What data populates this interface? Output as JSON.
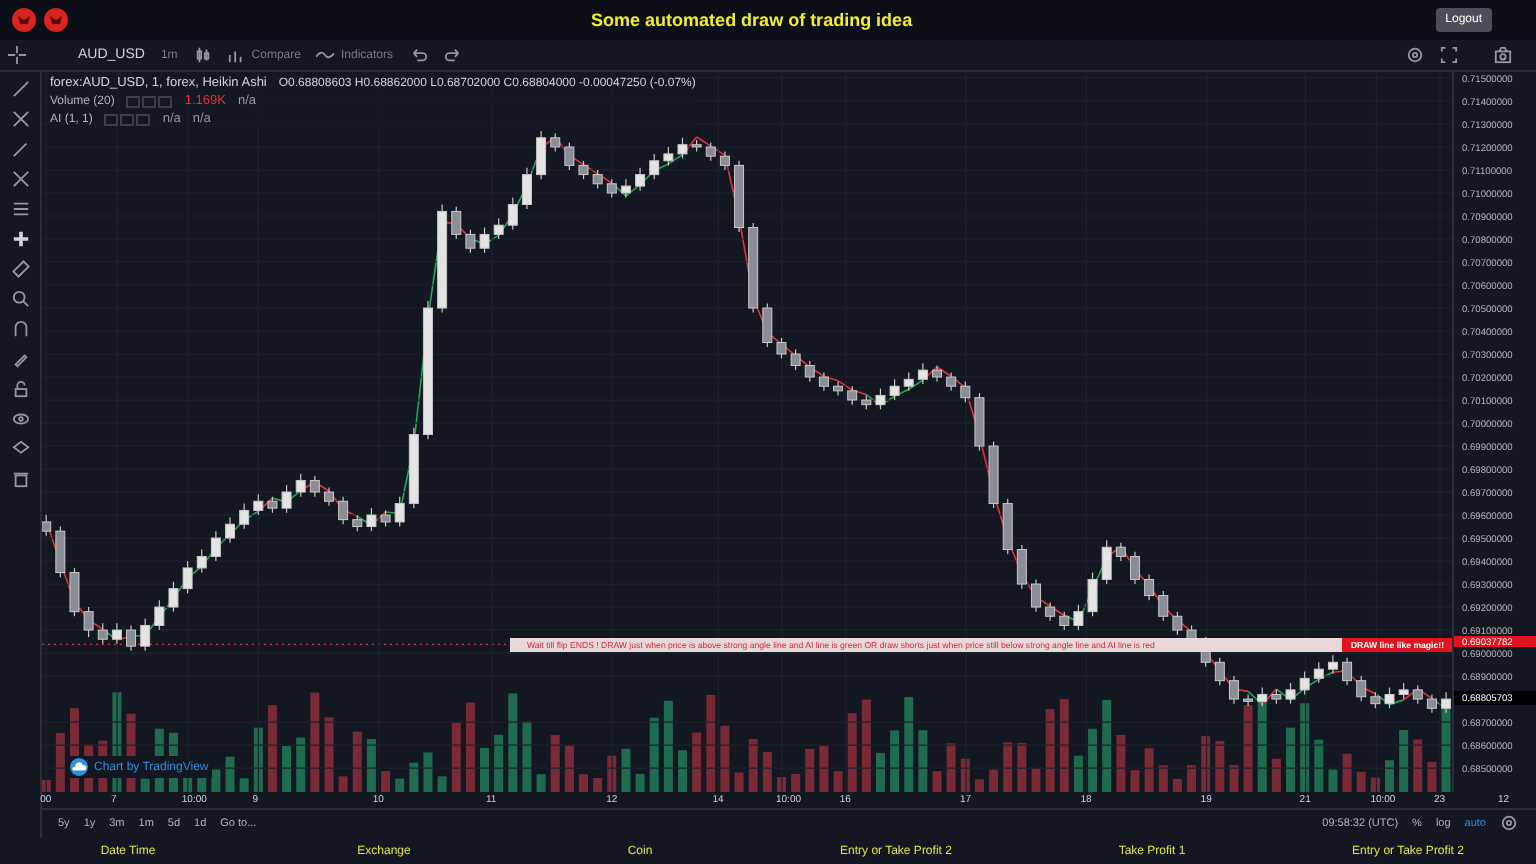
{
  "header": {
    "title": "Some automated draw of trading idea",
    "logout": "Logout"
  },
  "toolbar": {
    "symbol": "AUD_USD",
    "interval": "1m",
    "compare": "Compare",
    "indicators": "Indicators"
  },
  "legend": {
    "series": "forex:AUD_USD, 1, forex, Heikin Ashi",
    "ohlc": "O0.68808603 H0.68862000 L0.68702000 C0.68804000 -0.00047250 (-0.07%)",
    "studies": [
      {
        "name": "Volume (20)",
        "values": [
          {
            "text": "1.169K",
            "color": "#e0323c"
          },
          {
            "text": "n/a",
            "color": "#9598a1"
          }
        ]
      },
      {
        "name": "AI (1, 1)",
        "values": [
          {
            "text": "n/a",
            "color": "#9598a1"
          },
          {
            "text": "n/a",
            "color": "#9598a1"
          }
        ]
      }
    ]
  },
  "price_axis": {
    "last_price": "0.69037782",
    "crosshair_price": "0.68805703"
  },
  "chart": {
    "chart_data": {
      "type": "candlestick",
      "grid": true,
      "ylim": [
        0.68396,
        0.71526
      ],
      "categories": [
        null,
        null,
        null,
        null,
        null,
        null,
        null,
        null,
        null,
        null,
        null,
        null,
        null,
        null,
        null,
        null,
        null,
        null,
        null,
        null,
        null,
        null,
        null,
        null,
        null,
        null,
        null,
        null,
        null,
        null,
        null,
        null,
        null,
        null,
        null,
        null,
        null,
        null,
        null,
        null,
        null,
        null,
        null,
        null,
        null,
        null,
        null,
        null,
        null,
        null,
        null,
        null,
        null,
        null,
        null,
        null,
        null,
        null,
        null,
        null,
        null,
        null,
        null,
        null,
        null,
        null,
        null,
        null,
        null,
        null,
        null,
        null,
        null,
        null,
        null,
        null,
        null,
        null,
        null,
        null,
        null,
        null,
        null,
        null,
        null,
        null,
        null,
        null,
        null,
        null,
        null,
        null,
        null,
        null,
        null,
        null,
        null,
        null,
        null,
        null
      ],
      "yticks": [
        {
          "value": 0.715,
          "label": "0.71500000"
        },
        {
          "value": 0.714,
          "label": "0.71400000"
        },
        {
          "value": 0.713,
          "label": "0.71300000"
        },
        {
          "value": 0.712,
          "label": "0.71200000"
        },
        {
          "value": 0.711,
          "label": "0.71100000"
        },
        {
          "value": 0.71,
          "label": "0.71000000"
        },
        {
          "value": 0.709,
          "label": "0.70900000"
        },
        {
          "value": 0.708,
          "label": "0.70800000"
        },
        {
          "value": 0.707,
          "label": "0.70700000"
        },
        {
          "value": 0.706,
          "label": "0.70600000"
        },
        {
          "value": 0.705,
          "label": "0.70500000"
        },
        {
          "value": 0.704,
          "label": "0.70400000"
        },
        {
          "value": 0.703,
          "label": "0.70300000"
        },
        {
          "value": 0.702,
          "label": "0.70200000"
        },
        {
          "value": 0.701,
          "label": "0.70100000"
        },
        {
          "value": 0.7,
          "label": "0.70000000"
        },
        {
          "value": 0.699,
          "label": "0.69900000"
        },
        {
          "value": 0.698,
          "label": "0.69800000"
        },
        {
          "value": 0.697,
          "label": "0.69700000"
        },
        {
          "value": 0.696,
          "label": "0.69600000"
        },
        {
          "value": 0.695,
          "label": "0.69500000"
        },
        {
          "value": 0.694,
          "label": "0.69400000"
        },
        {
          "value": 0.693,
          "label": "0.69300000"
        },
        {
          "value": 0.692,
          "label": "0.69200000"
        },
        {
          "value": 0.691,
          "label": "0.69100000"
        },
        {
          "value": 0.69,
          "label": "0.69000000"
        },
        {
          "value": 0.689,
          "label": "0.68900000"
        },
        {
          "value": 0.687,
          "label": "0.68700000"
        },
        {
          "value": 0.686,
          "label": "0.68600000"
        },
        {
          "value": 0.685,
          "label": "0.68500000"
        }
      ],
      "ohlc": [
        [
          0.6957,
          0.696,
          0.6951,
          0.6953
        ],
        [
          0.6953,
          0.6955,
          0.6933,
          0.6935
        ],
        [
          0.6935,
          0.6937,
          0.6916,
          0.6918
        ],
        [
          0.6918,
          0.692,
          0.6907,
          0.691
        ],
        [
          0.691,
          0.6913,
          0.6904,
          0.6906
        ],
        [
          0.6906,
          0.6913,
          0.6904,
          0.691
        ],
        [
          0.691,
          0.6912,
          0.6901,
          0.6903
        ],
        [
          0.6903,
          0.6915,
          0.6901,
          0.6912
        ],
        [
          0.6912,
          0.6923,
          0.691,
          0.692
        ],
        [
          0.692,
          0.6931,
          0.6918,
          0.6928
        ],
        [
          0.6928,
          0.694,
          0.6926,
          0.6937
        ],
        [
          0.6937,
          0.6945,
          0.6935,
          0.6942
        ],
        [
          0.6942,
          0.6953,
          0.694,
          0.695
        ],
        [
          0.695,
          0.6959,
          0.6948,
          0.6956
        ],
        [
          0.6956,
          0.6965,
          0.6954,
          0.6962
        ],
        [
          0.6962,
          0.6969,
          0.696,
          0.6966
        ],
        [
          0.6966,
          0.6968,
          0.6961,
          0.6963
        ],
        [
          0.6963,
          0.6973,
          0.6961,
          0.697
        ],
        [
          0.697,
          0.6978,
          0.6968,
          0.6975
        ],
        [
          0.6975,
          0.6977,
          0.6968,
          0.697
        ],
        [
          0.697,
          0.6972,
          0.6964,
          0.6966
        ],
        [
          0.6966,
          0.6968,
          0.6956,
          0.6958
        ],
        [
          0.6958,
          0.696,
          0.6953,
          0.6955
        ],
        [
          0.6955,
          0.6963,
          0.6953,
          0.696
        ],
        [
          0.696,
          0.6962,
          0.6955,
          0.6957
        ],
        [
          0.6957,
          0.6968,
          0.6955,
          0.6965
        ],
        [
          0.6965,
          0.6998,
          0.6963,
          0.6995
        ],
        [
          0.6995,
          0.7053,
          0.6993,
          0.705
        ],
        [
          0.705,
          0.7095,
          0.7048,
          0.7092
        ],
        [
          0.7092,
          0.7094,
          0.708,
          0.7082
        ],
        [
          0.7082,
          0.7084,
          0.7074,
          0.7076
        ],
        [
          0.7076,
          0.7085,
          0.7074,
          0.7082
        ],
        [
          0.7082,
          0.7089,
          0.708,
          0.7086
        ],
        [
          0.7086,
          0.7098,
          0.7084,
          0.7095
        ],
        [
          0.7095,
          0.7111,
          0.7093,
          0.7108
        ],
        [
          0.7108,
          0.7127,
          0.7106,
          0.7124
        ],
        [
          0.7124,
          0.7126,
          0.7118,
          0.712
        ],
        [
          0.712,
          0.7122,
          0.711,
          0.7112
        ],
        [
          0.7112,
          0.7114,
          0.7106,
          0.7108
        ],
        [
          0.7108,
          0.711,
          0.7102,
          0.7104
        ],
        [
          0.7104,
          0.7106,
          0.7098,
          0.71
        ],
        [
          0.71,
          0.7106,
          0.7098,
          0.7103
        ],
        [
          0.7103,
          0.7111,
          0.7101,
          0.7108
        ],
        [
          0.7108,
          0.7117,
          0.7106,
          0.7114
        ],
        [
          0.7114,
          0.712,
          0.7112,
          0.7117
        ],
        [
          0.7117,
          0.7124,
          0.7115,
          0.7121
        ],
        [
          0.7121,
          0.7123,
          0.7118,
          0.712
        ],
        [
          0.712,
          0.7122,
          0.7114,
          0.7116
        ],
        [
          0.7116,
          0.7118,
          0.711,
          0.7112
        ],
        [
          0.7112,
          0.7114,
          0.7083,
          0.7085
        ],
        [
          0.7085,
          0.7087,
          0.7048,
          0.705
        ],
        [
          0.705,
          0.7052,
          0.7033,
          0.7035
        ],
        [
          0.7035,
          0.7037,
          0.7028,
          0.703
        ],
        [
          0.703,
          0.7032,
          0.7023,
          0.7025
        ],
        [
          0.7025,
          0.7027,
          0.7018,
          0.702
        ],
        [
          0.702,
          0.7022,
          0.7014,
          0.7016
        ],
        [
          0.7016,
          0.7018,
          0.7012,
          0.7014
        ],
        [
          0.7014,
          0.7016,
          0.7008,
          0.701
        ],
        [
          0.701,
          0.7012,
          0.7006,
          0.7008
        ],
        [
          0.7008,
          0.7015,
          0.7006,
          0.7012
        ],
        [
          0.7012,
          0.7019,
          0.701,
          0.7016
        ],
        [
          0.7016,
          0.7022,
          0.7014,
          0.7019
        ],
        [
          0.7019,
          0.7026,
          0.7017,
          0.7023
        ],
        [
          0.7023,
          0.7025,
          0.7018,
          0.702
        ],
        [
          0.702,
          0.7022,
          0.7014,
          0.7016
        ],
        [
          0.7016,
          0.7018,
          0.7009,
          0.7011
        ],
        [
          0.7011,
          0.7013,
          0.6988,
          0.699
        ],
        [
          0.699,
          0.6992,
          0.6963,
          0.6965
        ],
        [
          0.6965,
          0.6967,
          0.6943,
          0.6945
        ],
        [
          0.6945,
          0.6947,
          0.6928,
          0.693
        ],
        [
          0.693,
          0.6932,
          0.6918,
          0.692
        ],
        [
          0.692,
          0.6922,
          0.6914,
          0.6916
        ],
        [
          0.6916,
          0.6918,
          0.691,
          0.6912
        ],
        [
          0.6912,
          0.6921,
          0.691,
          0.6918
        ],
        [
          0.6918,
          0.6935,
          0.6916,
          0.6932
        ],
        [
          0.6932,
          0.6949,
          0.693,
          0.6946
        ],
        [
          0.6946,
          0.6948,
          0.694,
          0.6942
        ],
        [
          0.6942,
          0.6944,
          0.693,
          0.6932
        ],
        [
          0.6932,
          0.6934,
          0.6923,
          0.6925
        ],
        [
          0.6925,
          0.6927,
          0.6914,
          0.6916
        ],
        [
          0.6916,
          0.6918,
          0.6908,
          0.691
        ],
        [
          0.691,
          0.6912,
          0.6903,
          0.6905
        ],
        [
          0.6905,
          0.6907,
          0.6894,
          0.6896
        ],
        [
          0.6896,
          0.6898,
          0.6886,
          0.6888
        ],
        [
          0.6888,
          0.689,
          0.6878,
          0.688
        ],
        [
          0.688,
          0.6882,
          0.6877,
          0.6879
        ],
        [
          0.6879,
          0.6885,
          0.6877,
          0.6882
        ],
        [
          0.6882,
          0.6884,
          0.6878,
          0.688
        ],
        [
          0.688,
          0.6887,
          0.6878,
          0.6884
        ],
        [
          0.6884,
          0.6892,
          0.6882,
          0.6889
        ],
        [
          0.6889,
          0.6896,
          0.6887,
          0.6893
        ],
        [
          0.6893,
          0.6899,
          0.6891,
          0.6896
        ],
        [
          0.6896,
          0.6898,
          0.6886,
          0.6888
        ],
        [
          0.6888,
          0.689,
          0.6879,
          0.6881
        ],
        [
          0.6881,
          0.6883,
          0.6876,
          0.6878
        ],
        [
          0.6878,
          0.6885,
          0.6876,
          0.6882
        ],
        [
          0.6882,
          0.6887,
          0.688,
          0.6884
        ],
        [
          0.6884,
          0.6886,
          0.6878,
          0.688
        ],
        [
          0.688,
          0.6882,
          0.6874,
          0.6876
        ],
        [
          0.6876,
          0.6883,
          0.6874,
          0.688
        ]
      ]
    }
  },
  "time_axis": [
    "00",
    "7",
    "10:00",
    "9",
    "10",
    "11",
    "12",
    "14",
    "10:00",
    "16",
    "17",
    "18",
    "19",
    "21",
    "10:00",
    "23",
    "12"
  ],
  "note": {
    "text": "Wait till flip ENDS !   DRAW just when price is above strong angle line and AI line is green      OR      draw shorts just when price still below strong angle line and AI line is red",
    "tag": "DRAW line like magic!!"
  },
  "attribution": "Chart by TradingView",
  "periods": [
    "5y",
    "1y",
    "3m",
    "1m",
    "5d",
    "1d",
    "Go to..."
  ],
  "status": {
    "time": "09:58:32 (UTC)",
    "percent": "%",
    "log": "log",
    "auto": "auto"
  },
  "footer": [
    "Date Time",
    "Exchange",
    "Coin",
    "Entry or Take Profit 2",
    "Take Profit 1",
    "Entry or Take Profit 2"
  ]
}
